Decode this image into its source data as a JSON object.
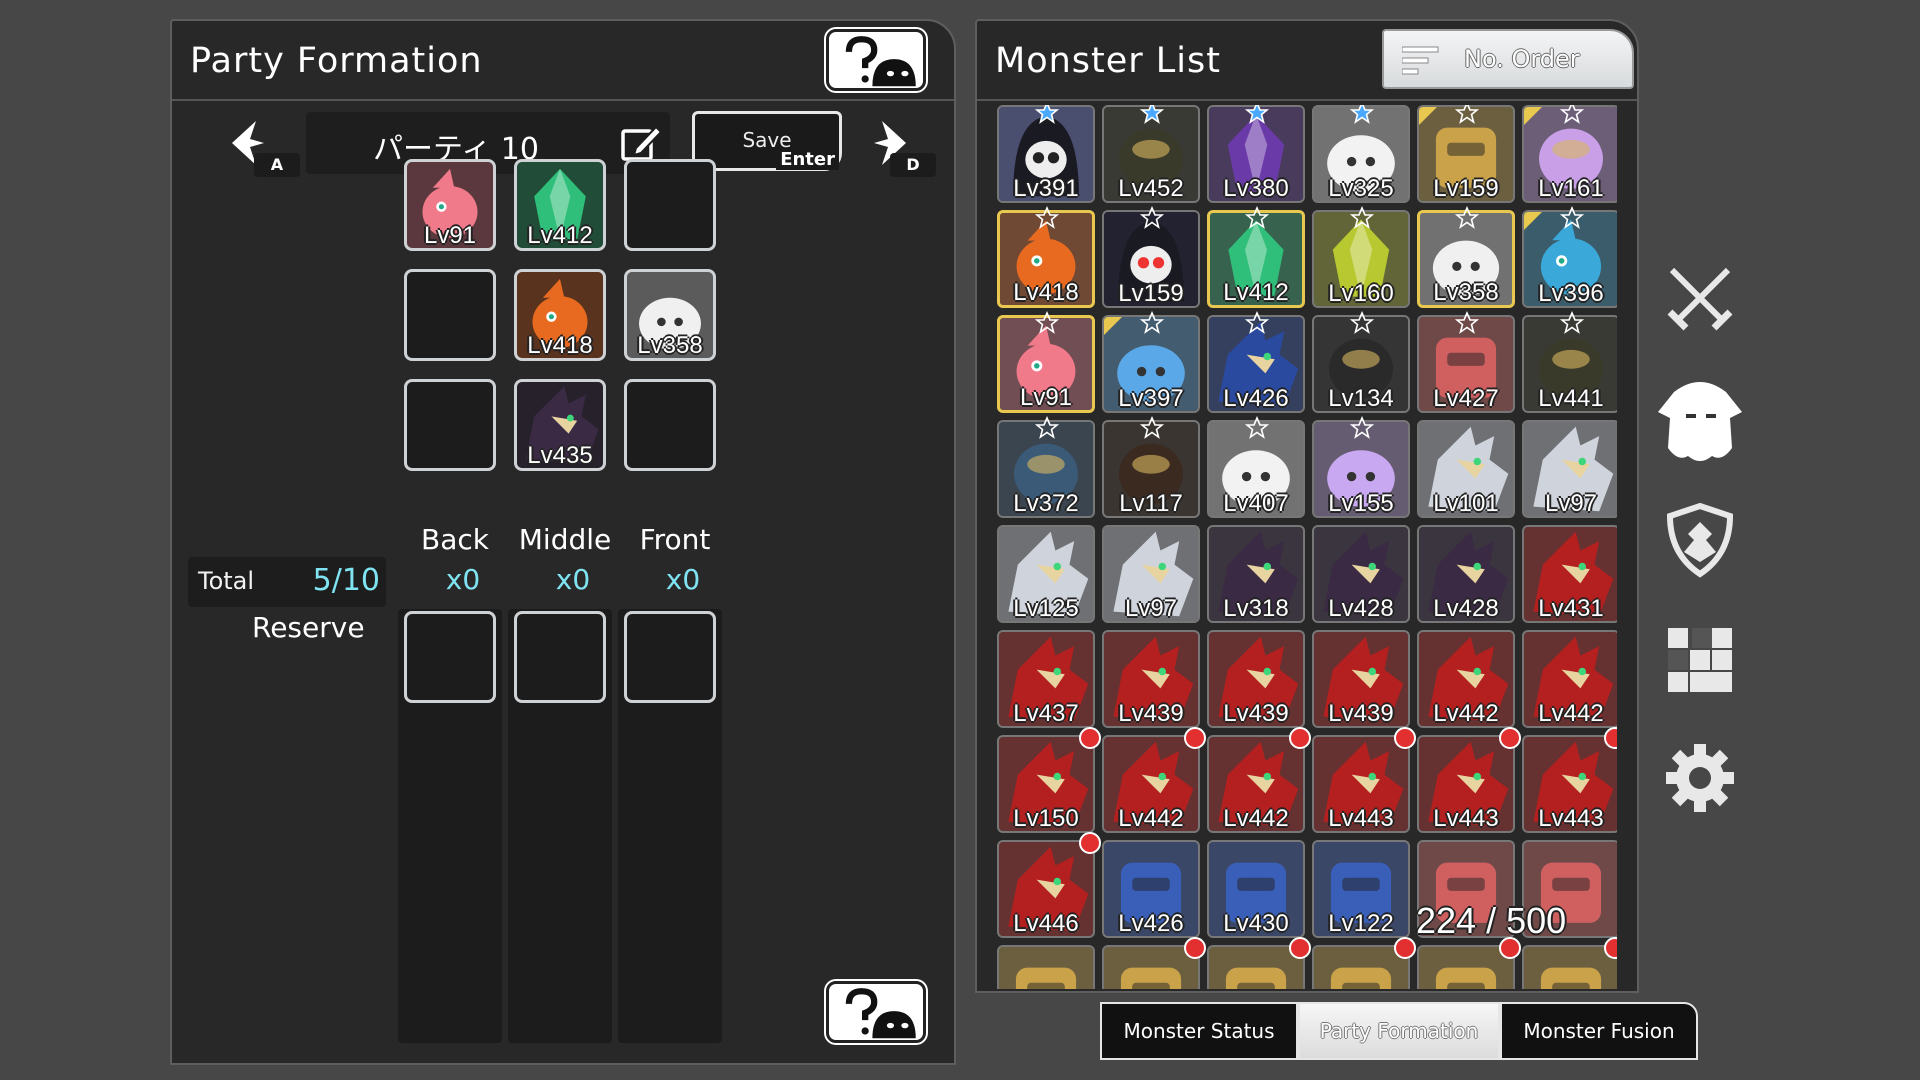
{
  "party_formation": {
    "title": "Party Formation",
    "party_name": "パーティ 10",
    "prev_key": "A",
    "next_key": "D",
    "save_label": "Save",
    "save_key": "Enter",
    "grid": [
      [
        {
          "lv": "Lv91",
          "type": "pink-bird"
        },
        {
          "lv": "Lv412",
          "type": "green-crystal"
        },
        null
      ],
      [
        null,
        {
          "lv": "Lv418",
          "type": "phoenix"
        },
        {
          "lv": "Lv358",
          "type": "white-ghost"
        }
      ],
      [
        null,
        {
          "lv": "Lv435",
          "type": "dark-dragon"
        },
        null
      ]
    ],
    "columns": [
      {
        "label": "Back",
        "count": "x0"
      },
      {
        "label": "Middle",
        "count": "x0"
      },
      {
        "label": "Front",
        "count": "x0"
      }
    ],
    "total_label": "Total",
    "total_value": "5/10",
    "reserve_label": "Reserve"
  },
  "monster_list": {
    "title": "Monster List",
    "sort_label": "No. Order",
    "count_text": "224 / 500",
    "rows": [
      [
        {
          "lv": "Lv391",
          "type": "skull-hood",
          "star": "blue"
        },
        {
          "lv": "Lv452",
          "type": "gold-beetle",
          "star": "blue"
        },
        {
          "lv": "Lv380",
          "type": "purple-crystal",
          "star": "blue"
        },
        {
          "lv": "Lv325",
          "type": "white-bunny",
          "star": "blue"
        },
        {
          "lv": "Lv159",
          "type": "gold-golem",
          "star": "white",
          "gold_corner": true
        },
        {
          "lv": "Lv161",
          "type": "unicorn",
          "star": "white",
          "gold_corner": true
        }
      ],
      [
        {
          "lv": "Lv418",
          "type": "phoenix",
          "star": "white",
          "gold": true
        },
        {
          "lv": "Lv159",
          "type": "skull-dark",
          "star": "white"
        },
        {
          "lv": "Lv412",
          "type": "green-crystal",
          "star": "white",
          "gold": true
        },
        {
          "lv": "Lv160",
          "type": "yellow-crystal",
          "star": "white"
        },
        {
          "lv": "Lv358",
          "type": "white-ghost",
          "star": "white",
          "gold": true
        },
        {
          "lv": "Lv396",
          "type": "blue-bird",
          "star": "white",
          "gold_corner": true
        }
      ],
      [
        {
          "lv": "Lv91",
          "type": "pink-bird",
          "star": "white",
          "gold": true
        },
        {
          "lv": "Lv397",
          "type": "blue-slime",
          "star": "white",
          "gold_corner": true
        },
        {
          "lv": "Lv426",
          "type": "blue-dragon",
          "star": "white"
        },
        {
          "lv": "Lv134",
          "type": "black-gold",
          "star": "white"
        },
        {
          "lv": "Lv427",
          "type": "red-golem",
          "star": "white"
        },
        {
          "lv": "Lv441",
          "type": "gold-beetle",
          "star": "white"
        }
      ],
      [
        {
          "lv": "Lv372",
          "type": "blue-beast",
          "star": "white"
        },
        {
          "lv": "Lv117",
          "type": "brown-beast",
          "star": "white"
        },
        {
          "lv": "Lv407",
          "type": "white-bunny",
          "star": "white"
        },
        {
          "lv": "Lv155",
          "type": "rainbow-slime",
          "star": "white"
        },
        {
          "lv": "Lv101",
          "type": "silver-dragon"
        },
        {
          "lv": "Lv97",
          "type": "silver-dragon"
        }
      ],
      [
        {
          "lv": "Lv125",
          "type": "silver-dragon"
        },
        {
          "lv": "Lv97",
          "type": "silver-dragon"
        },
        {
          "lv": "Lv318",
          "type": "dark-dragon"
        },
        {
          "lv": "Lv428",
          "type": "dark-dragon"
        },
        {
          "lv": "Lv428",
          "type": "dark-dragon"
        },
        {
          "lv": "Lv431",
          "type": "red-dragon"
        }
      ],
      [
        {
          "lv": "Lv437",
          "type": "red-dragon"
        },
        {
          "lv": "Lv439",
          "type": "red-dragon"
        },
        {
          "lv": "Lv439",
          "type": "red-dragon"
        },
        {
          "lv": "Lv439",
          "type": "red-dragon"
        },
        {
          "lv": "Lv442",
          "type": "red-dragon"
        },
        {
          "lv": "Lv442",
          "type": "red-dragon"
        }
      ],
      [
        {
          "lv": "Lv150",
          "type": "red-dragon",
          "new": true
        },
        {
          "lv": "Lv442",
          "type": "red-dragon",
          "new": true
        },
        {
          "lv": "Lv442",
          "type": "red-dragon",
          "new": true
        },
        {
          "lv": "Lv443",
          "type": "red-dragon",
          "new": true
        },
        {
          "lv": "Lv443",
          "type": "red-dragon",
          "new": true
        },
        {
          "lv": "Lv443",
          "type": "red-dragon",
          "new": true
        }
      ],
      [
        {
          "lv": "Lv446",
          "type": "red-dragon",
          "new": true
        },
        {
          "lv": "Lv426",
          "type": "blue-golem"
        },
        {
          "lv": "Lv430",
          "type": "blue-golem"
        },
        {
          "lv": "Lv122",
          "type": "blue-golem"
        },
        {
          "lv": "",
          "type": "red-golem"
        },
        {
          "lv": "",
          "type": "red-golem"
        }
      ],
      [
        {
          "lv": "",
          "type": "gold-golem"
        },
        {
          "lv": "",
          "type": "gold-golem",
          "new": true
        },
        {
          "lv": "",
          "type": "gold-golem",
          "new": true
        },
        {
          "lv": "",
          "type": "gold-golem",
          "new": true
        },
        {
          "lv": "",
          "type": "gold-golem",
          "new": true
        },
        {
          "lv": "",
          "type": "gold-golem",
          "new": true
        }
      ]
    ]
  },
  "tabs": [
    {
      "label": "Monster Status",
      "active": false
    },
    {
      "label": "Party Formation",
      "active": true
    },
    {
      "label": "Monster Fusion",
      "active": false
    }
  ],
  "side_icons": [
    "crossed-swords-icon",
    "monster-ghost-icon",
    "shield-crest-icon",
    "map-grid-icon",
    "gear-icon"
  ],
  "colors": {
    "panel": "#282828",
    "background": "#474747",
    "accent_cyan": "#7fe3f2",
    "gold": "#e9c850",
    "new_badge": "#e23030",
    "red-dragon": "#b42020",
    "dark-dragon": "#3a2a44",
    "silver-dragon": "#cfd4dc",
    "blue-golem": "#3a5fb8",
    "red-golem": "#d06060",
    "gold-golem": "#c9a24a",
    "pink-bird": "#f07a8a",
    "green-crystal": "#2fbf7a",
    "phoenix": "#e86a20",
    "white-ghost": "#f0f0f0",
    "skull-hood": "#4a4f70",
    "skull-dark": "#222230",
    "gold-beetle": "#3a3a2a",
    "purple-crystal": "#6a3aa8",
    "white-bunny": "#f2f2f2",
    "unicorn": "#c9a0e8",
    "yellow-crystal": "#b8c830",
    "blue-bird": "#3aa8d8",
    "blue-slime": "#5aa8e8",
    "blue-dragon": "#2a4aa0",
    "black-gold": "#2a2a2a",
    "blue-beast": "#3a5a78",
    "brown-beast": "#3a2a20",
    "rainbow-slime": "#c8a8f0"
  }
}
